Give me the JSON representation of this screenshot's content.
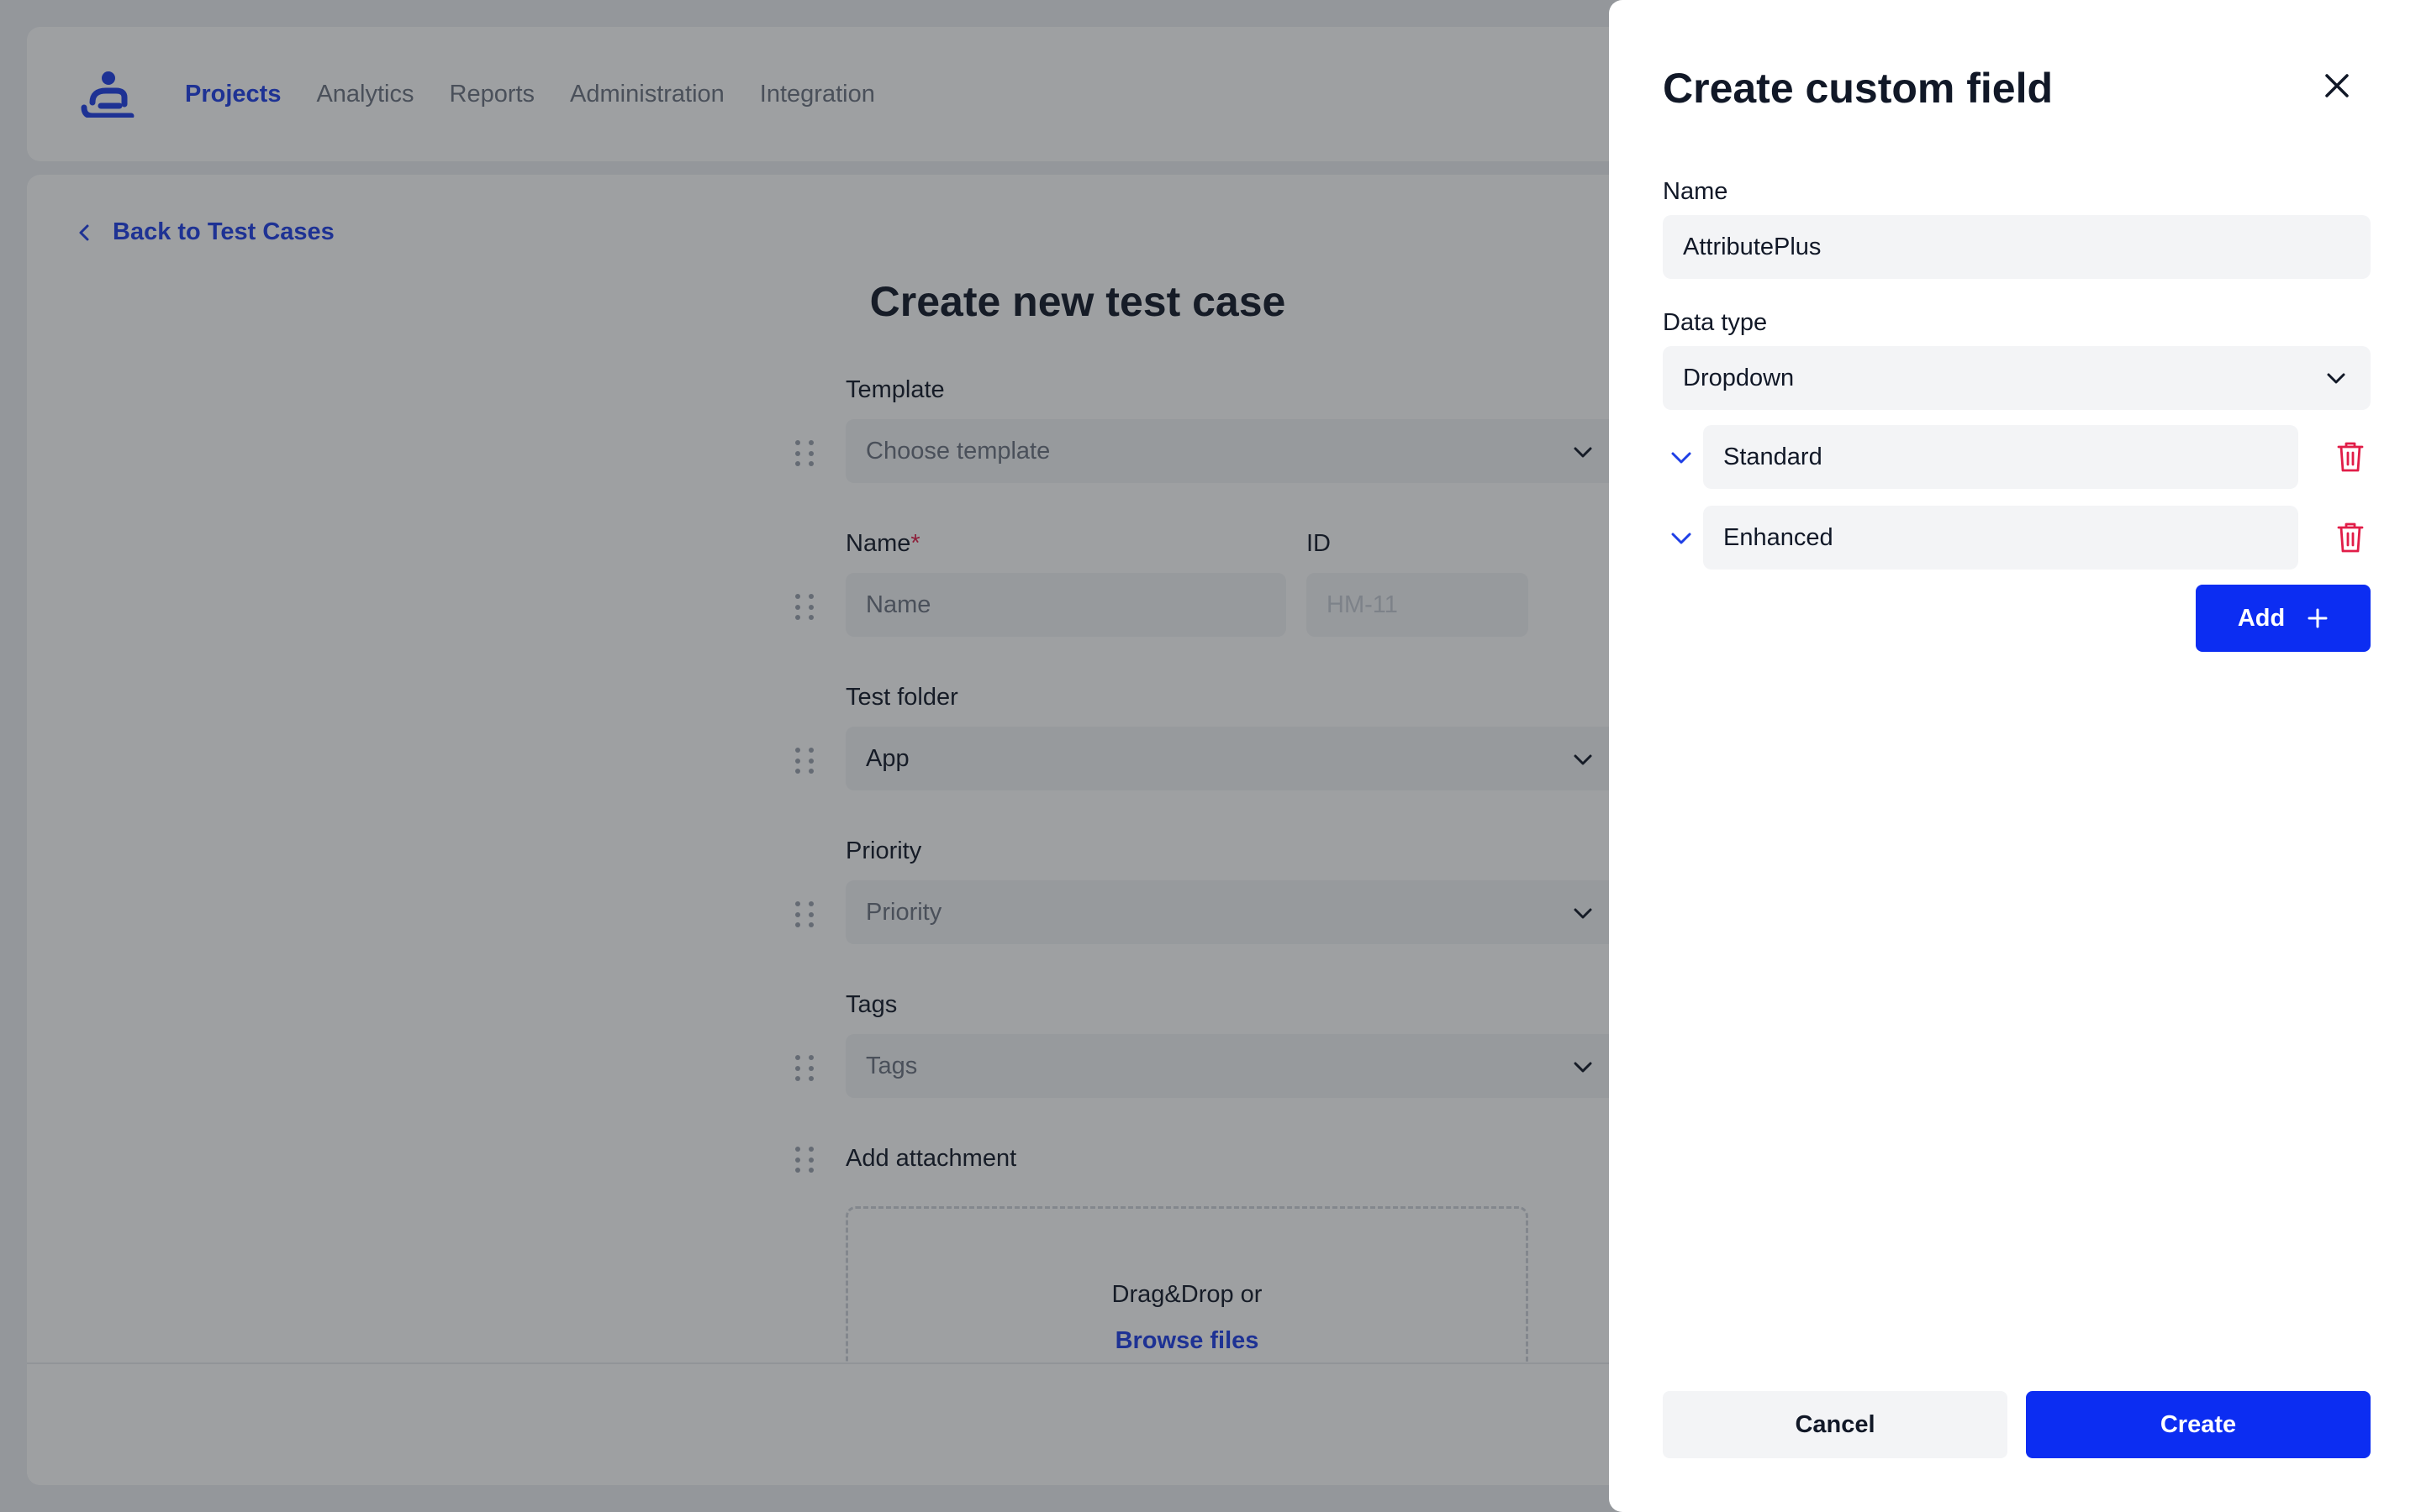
{
  "colors": {
    "accent": "#0c2df2",
    "link": "#1e3fe6",
    "danger": "#e11d48",
    "field_bg": "#f3f4f6",
    "overlay": "rgba(30,34,40,0.43)"
  },
  "nav": {
    "logo_icon": "app-logo-icon",
    "items": [
      "Projects",
      "Analytics",
      "Reports",
      "Administration",
      "Integration"
    ],
    "active": "Projects"
  },
  "back_link": {
    "label": "Back to Test Cases",
    "icon": "chevron-left-icon"
  },
  "page_title": "Create new test case",
  "form": {
    "template": {
      "label": "Template",
      "placeholder": "Choose template"
    },
    "name": {
      "label": "Name",
      "required_mark": "*",
      "placeholder": "Name"
    },
    "id": {
      "label": "ID",
      "value": "HM-11"
    },
    "test_folder": {
      "label": "Test folder",
      "value": "App"
    },
    "priority": {
      "label": "Priority",
      "placeholder": "Priority"
    },
    "tags": {
      "label": "Tags",
      "placeholder": "Tags"
    },
    "attachment": {
      "label": "Add attachment",
      "drop_text": "Drag&Drop or",
      "browse_label": "Browse files"
    }
  },
  "panel": {
    "title": "Create custom field",
    "close_icon": "close-icon",
    "name": {
      "label": "Name",
      "value": "AttributePlus"
    },
    "data_type": {
      "label": "Data type",
      "value": "Dropdown"
    },
    "options": [
      {
        "value": "Standard"
      },
      {
        "value": "Enhanced"
      }
    ],
    "add_label": "Add",
    "cancel_label": "Cancel",
    "create_label": "Create"
  }
}
